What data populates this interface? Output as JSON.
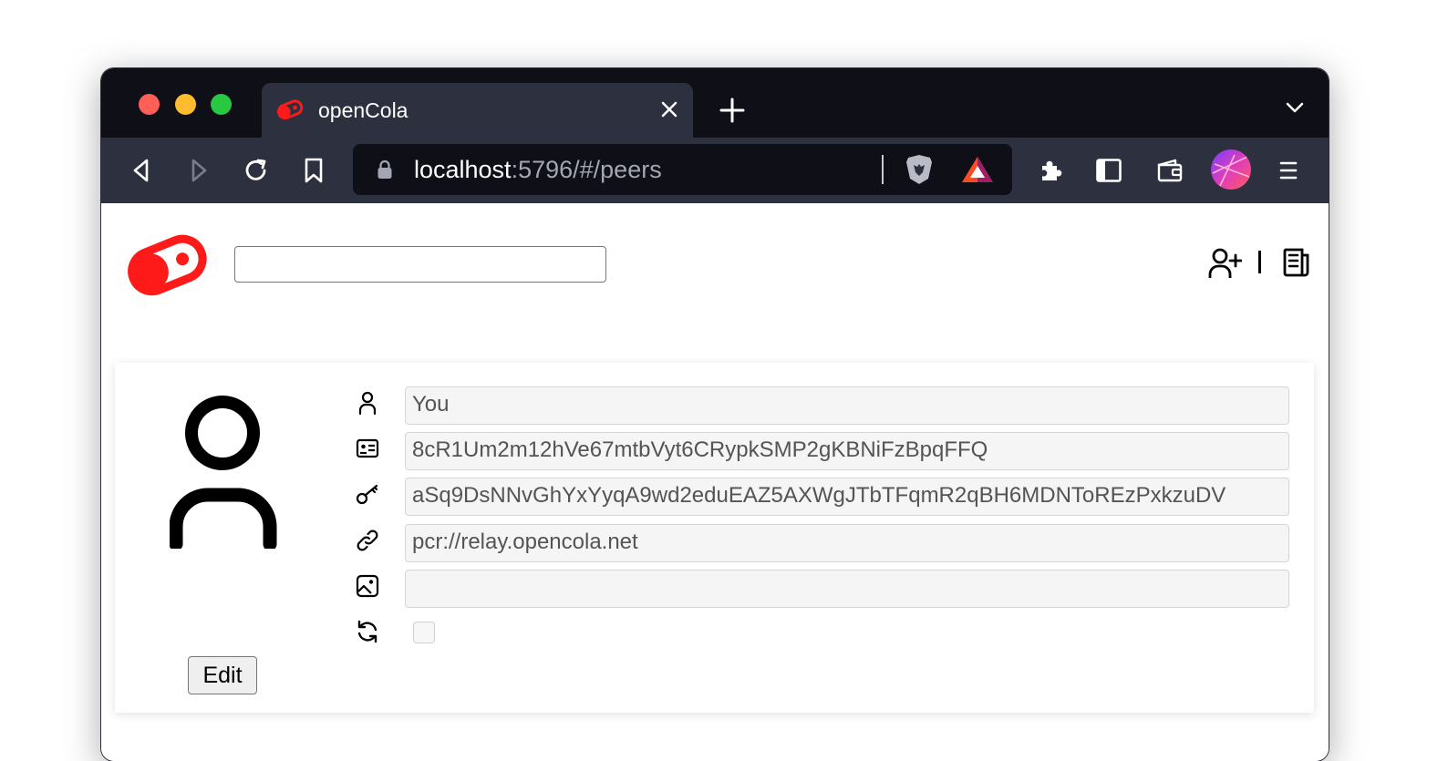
{
  "browser": {
    "tab_title": "openCola",
    "url_host": "localhost",
    "url_rest": ":5796/#/peers"
  },
  "page": {
    "search": {
      "value": "",
      "placeholder": ""
    },
    "profile": {
      "name": "You",
      "id": "8cR1Um2m12hVe67mtbVyt6CRypkSMP2gKBNiFzBpqFFQ",
      "public_key": "aSq9DsNNvGhYxYyqA9wd2eduEAZ5AXWgJTbTFqmR2qBH6MDNToREzPxkzuDV",
      "address": "pcr://relay.opencola.net",
      "image_uri": "",
      "sync_enabled": false,
      "edit_label": "Edit"
    }
  },
  "icons": {
    "tab_logo": "opencola-logo-icon",
    "name_row": "person-icon",
    "id_row": "id-card-icon",
    "key_row": "key-icon",
    "address_row": "link-icon",
    "image_row": "image-icon",
    "sync_row": "sync-icon"
  },
  "colors": {
    "brand_red": "#ff1a1a",
    "tabbar_bg": "#0e0f17",
    "toolbar_bg": "#2d303e"
  }
}
